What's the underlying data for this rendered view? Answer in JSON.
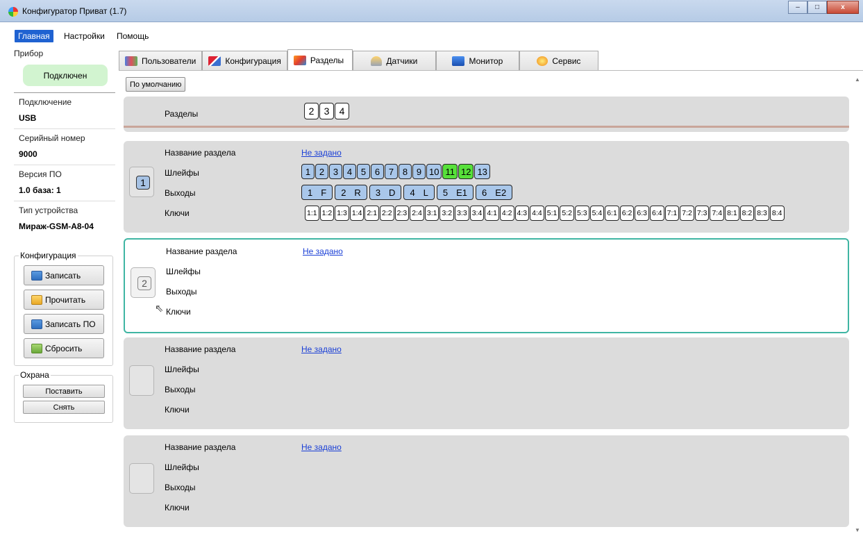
{
  "window": {
    "title": "Конфигуратор Приват (1.7)",
    "btn_minimize": "–",
    "btn_maximize": "□",
    "btn_close": "x"
  },
  "menu": {
    "items": [
      "Главная",
      "Настройки",
      "Помощь"
    ]
  },
  "left": {
    "device_group": "Прибор",
    "status": "Подключен",
    "connection_label": "Подключение",
    "connection_value": "USB",
    "serial_label": "Серийный номер",
    "serial_value": "9000",
    "fw_label": "Версия ПО",
    "fw_value": "1.0 база: 1",
    "type_label": "Тип устройства",
    "type_value": "Мираж-GSM-A8-04",
    "config_group": "Конфигурация",
    "btn_write": "Записать",
    "btn_read": "Прочитать",
    "btn_write_fw": "Записать ПО",
    "btn_reset": "Сбросить",
    "guard_group": "Охрана",
    "btn_arm": "Поставить",
    "btn_disarm": "Снять"
  },
  "tabs": [
    "Пользователи",
    "Конфигурация",
    "Разделы",
    "Датчики",
    "Монитор",
    "Сервис"
  ],
  "default_btn": "По умолчанию",
  "sections_header": {
    "label": "Разделы",
    "numbers": [
      "2",
      "3",
      "4"
    ]
  },
  "labels": {
    "name": "Название раздела",
    "loops": "Шлейфы",
    "outputs": "Выходы",
    "keys": "Ключи"
  },
  "partitions": [
    {
      "number": "1",
      "name": "Не задано",
      "loops": [
        "1",
        "2",
        "3",
        "4",
        "5",
        "6",
        "7",
        "8",
        "9",
        "10",
        "11",
        "12",
        "13"
      ],
      "loop_states": [
        "blue",
        "blue",
        "blue",
        "blue",
        "blue",
        "blue",
        "blue",
        "blue",
        "blue",
        "blue",
        "green",
        "green",
        "blue"
      ],
      "outputs": [
        [
          "1",
          "F"
        ],
        [
          "2",
          "R"
        ],
        [
          "3",
          "D"
        ],
        [
          "4",
          "L"
        ],
        [
          "5",
          "E1"
        ],
        [
          "6",
          "E2"
        ]
      ],
      "keys": [
        "1:1",
        "1:2",
        "1:3",
        "1:4",
        "2:1",
        "2:2",
        "2:3",
        "2:4",
        "3:1",
        "3:2",
        "3:3",
        "3:4",
        "4:1",
        "4:2",
        "4:3",
        "4:4",
        "5:1",
        "5:2",
        "5:3",
        "5:4",
        "6:1",
        "6:2",
        "6:3",
        "6:4",
        "7:1",
        "7:2",
        "7:3",
        "7:4",
        "8:1",
        "8:2",
        "8:3",
        "8:4"
      ]
    },
    {
      "number": "2",
      "name": "Не задано"
    },
    {
      "number": "",
      "name": "Не задано"
    },
    {
      "number": "",
      "name": "Не задано"
    }
  ]
}
